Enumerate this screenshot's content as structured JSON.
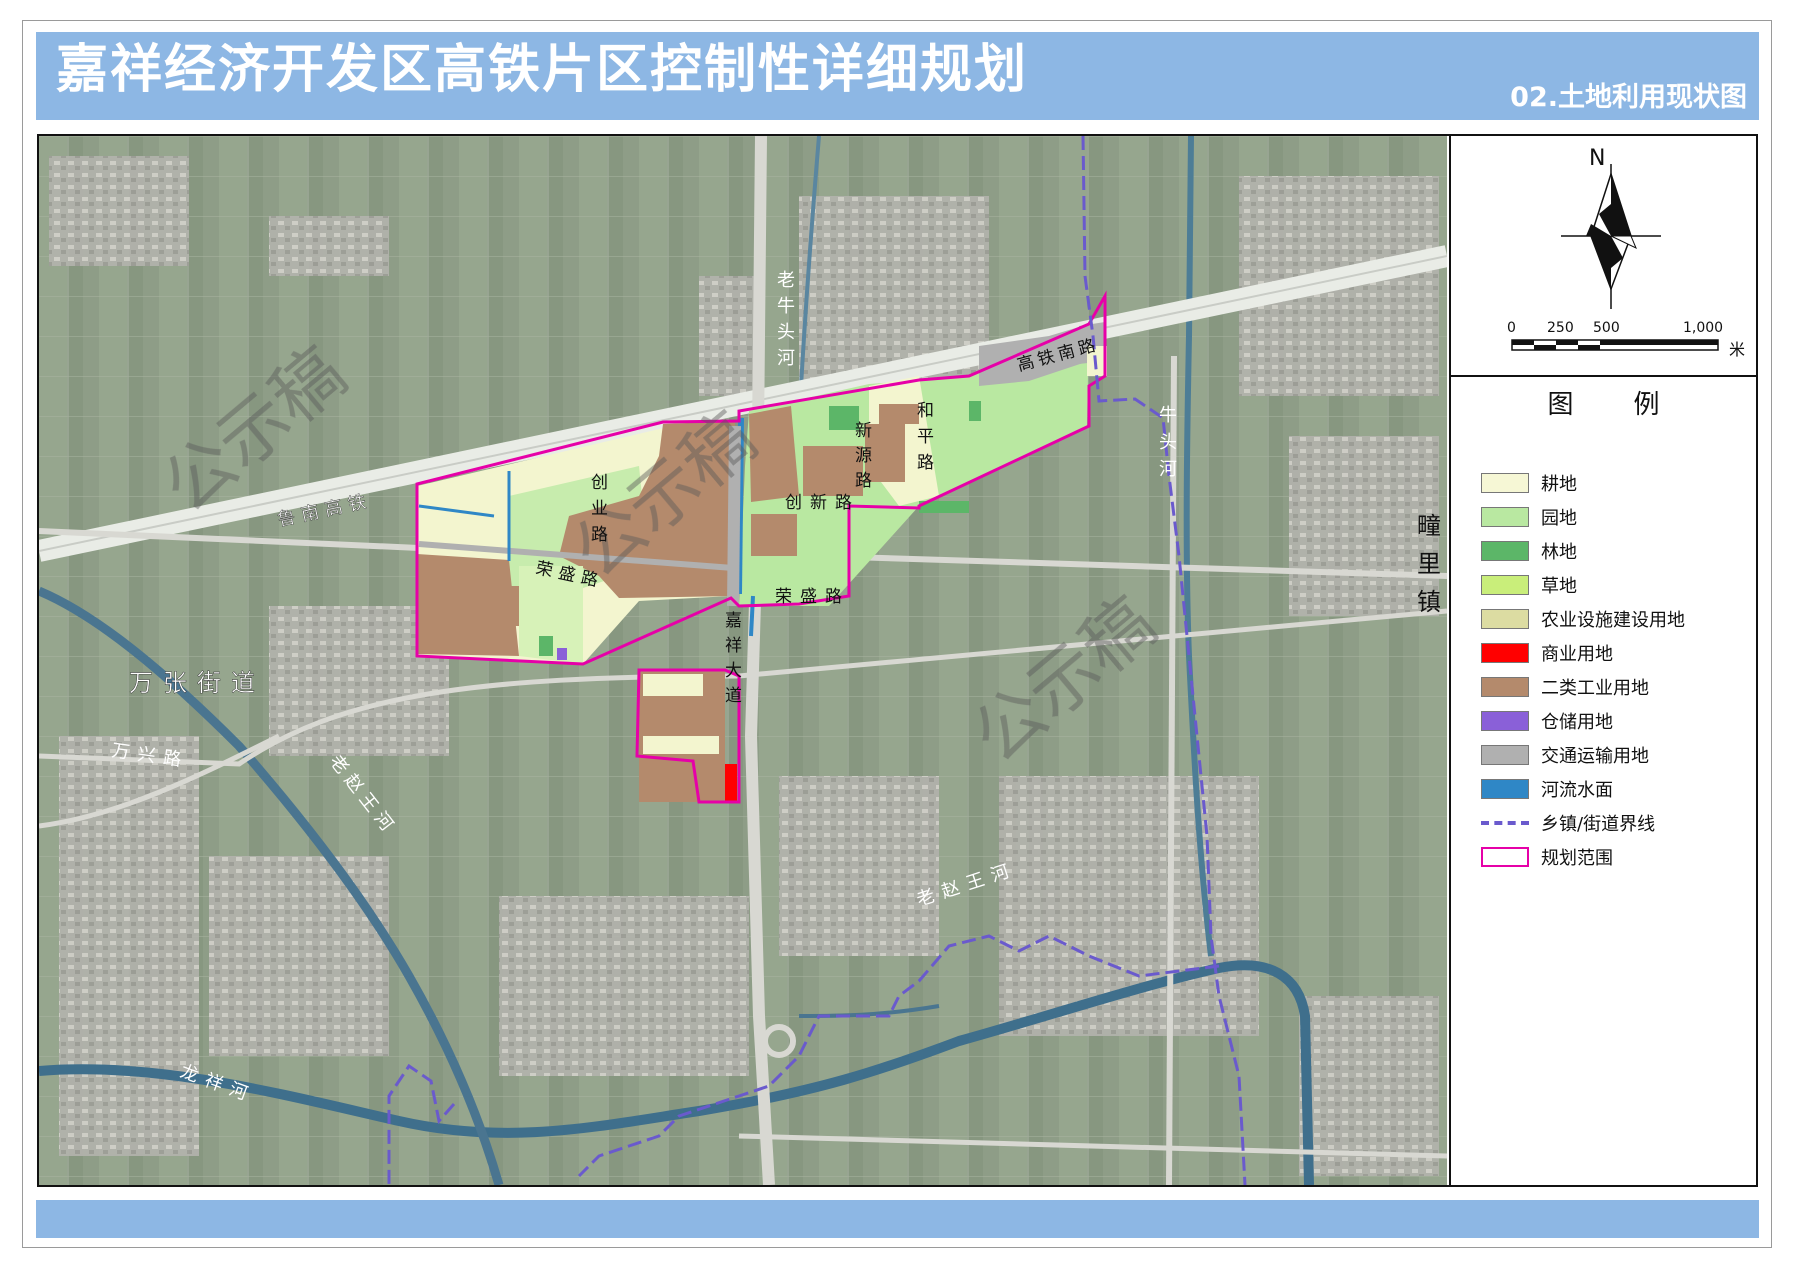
{
  "title": "嘉祥经济开发区高铁片区控制性详细规划",
  "subtitle": "02.土地利用现状图",
  "north_label": "N",
  "scale": {
    "ticks": [
      "0",
      "250",
      "500",
      "1,000"
    ],
    "unit": "米"
  },
  "legend": {
    "title": "图例",
    "items": [
      {
        "label": "耕地",
        "color": "#f6f7d5",
        "kind": "fill"
      },
      {
        "label": "园地",
        "color": "#b9e8a1",
        "kind": "fill"
      },
      {
        "label": "林地",
        "color": "#5cb668",
        "kind": "fill"
      },
      {
        "label": "草地",
        "color": "#c9ee7a",
        "kind": "fill"
      },
      {
        "label": "农业设施建设用地",
        "color": "#dcdca2",
        "kind": "fill"
      },
      {
        "label": "商业用地",
        "color": "#ff0000",
        "kind": "fill"
      },
      {
        "label": "二类工业用地",
        "color": "#b48a6c",
        "kind": "fill"
      },
      {
        "label": "仓储用地",
        "color": "#8a60d8",
        "kind": "fill"
      },
      {
        "label": "交通运输用地",
        "color": "#b0b0b0",
        "kind": "fill"
      },
      {
        "label": "河流水面",
        "color": "#2f87c6",
        "kind": "fill"
      },
      {
        "label": "乡镇/街道界线",
        "color": "#6a5acd",
        "kind": "dashed"
      },
      {
        "label": "规划范围",
        "color": "#e600a8",
        "kind": "outline"
      }
    ]
  },
  "map_labels": {
    "road_lunan": "鲁南高铁",
    "road_wanxing": "万兴路",
    "river_longxiang": "龙祥河",
    "river_laozhaowang_w": "老赵王河",
    "river_laozhaowang_e": "老赵王河",
    "river_laoniutou": "老牛头河",
    "river_niutou": "牛头河",
    "road_chuangye": "创业路",
    "road_rongsheng_w": "荣盛路",
    "road_rongsheng_e": "荣盛路",
    "road_chuangxin": "创新路",
    "road_xinyuan": "新源路",
    "road_heping": "和平路",
    "road_gaotienan": "高铁南路",
    "road_jiaxiang": "嘉祥大道",
    "area_wanzhang": "万张街道",
    "area_tongli": "疃里镇",
    "watermark": "公示稿"
  }
}
